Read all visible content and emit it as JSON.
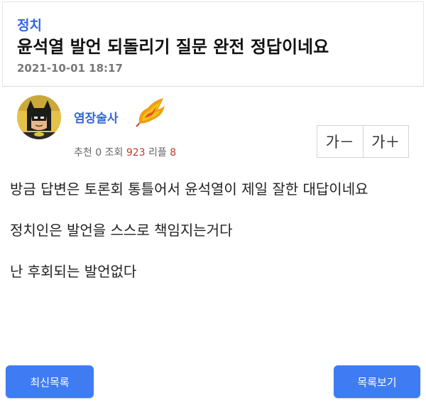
{
  "post": {
    "category": "정치",
    "title": "윤석열 발언 되돌리기 질문 완전 정답이네요",
    "date": "2021-10-01 18:17"
  },
  "author": {
    "nickname": "염장술사",
    "stats": {
      "recommend_label": "추천",
      "recommend_value": "0",
      "views_label": "조회",
      "views_value": "923",
      "replies_label": "리플",
      "replies_value": "8"
    }
  },
  "font_controls": {
    "decrease_label": "가－",
    "increase_label": "가＋"
  },
  "content": {
    "paragraphs": [
      "방금 답변은 토론회 통틀어서 윤석열이 제일 잘한 대답이네요",
      "정치인은 발언을 스스로 책임지는거다",
      "난 후회되는 발언없다"
    ]
  },
  "buttons": {
    "latest_list": "최신목록",
    "view_list": "목록보기"
  },
  "colors": {
    "accent": "#3367d6",
    "button_blue": "#3f7cf3",
    "stat_red": "#c0392b"
  }
}
